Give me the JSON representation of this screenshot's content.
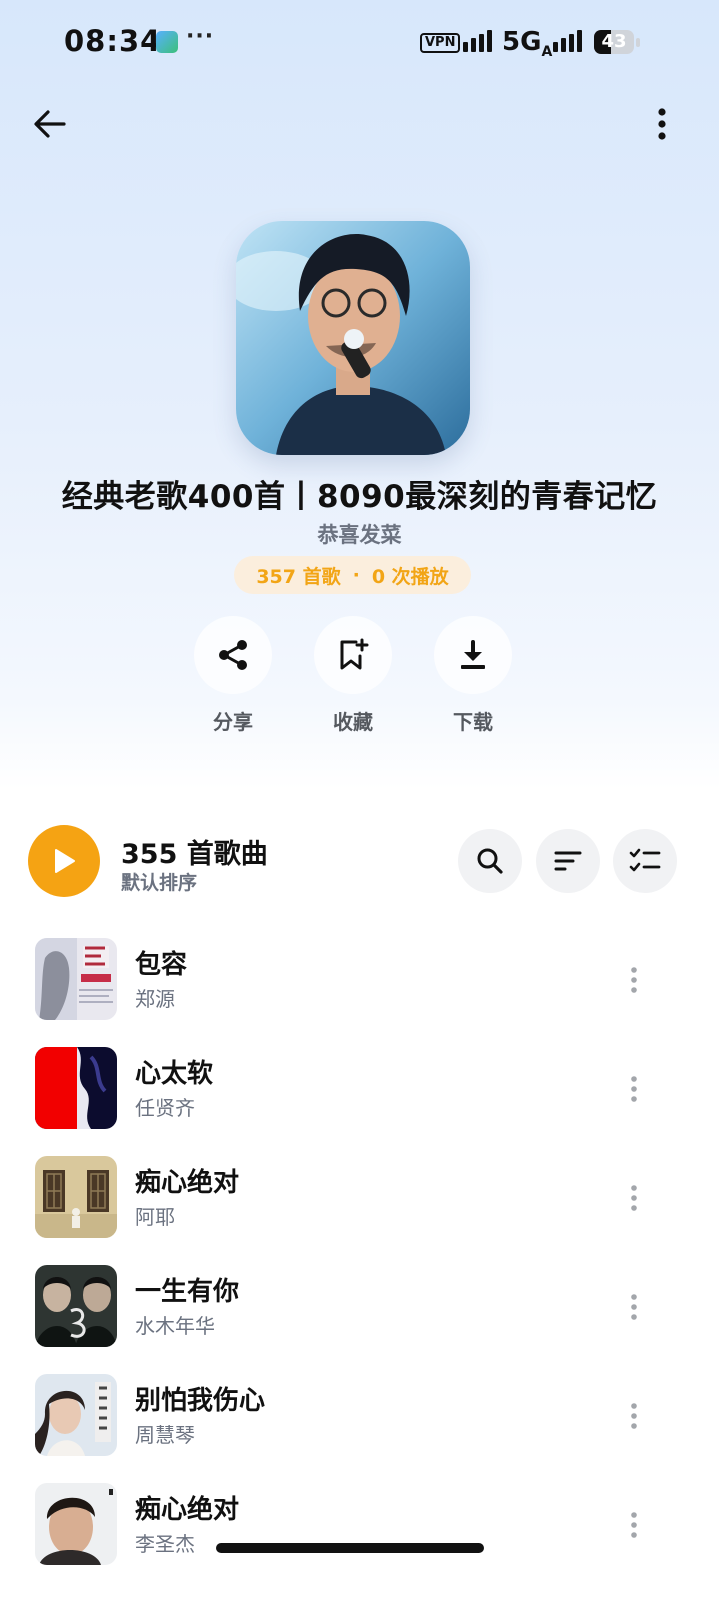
{
  "status_bar": {
    "time": "08:34",
    "dots": "···",
    "vpn": "VPN",
    "network": "5G",
    "network_sub": "A",
    "battery": "43",
    "battery_level": 0.43
  },
  "nav": {
    "back_icon": "arrow-left-icon",
    "more_icon": "more-vertical-icon"
  },
  "playlist": {
    "title": "经典老歌400首丨8090最深刻的青春记忆",
    "creator": "恭喜发菜",
    "song_count_label": "357 首歌",
    "separator": "·",
    "plays_label": "0 次播放"
  },
  "actions": [
    {
      "label": "分享",
      "icon": "share-icon"
    },
    {
      "label": "收藏",
      "icon": "bookmark-add-icon"
    },
    {
      "label": "下载",
      "icon": "download-icon"
    }
  ],
  "list_header": {
    "count_label": "355 首歌曲",
    "sort_label": "默认排序"
  },
  "songs": [
    {
      "title": "包容",
      "artist": "郑源"
    },
    {
      "title": "心太软",
      "artist": "任贤齐"
    },
    {
      "title": "痴心绝对",
      "artist": "阿耶"
    },
    {
      "title": "一生有你",
      "artist": "水木年华"
    },
    {
      "title": "别怕我伤心",
      "artist": "周慧琴"
    },
    {
      "title": "痴心绝对",
      "artist": "李圣杰"
    }
  ],
  "colors": {
    "accent": "#f5a313",
    "stats_text": "#f2a516",
    "stats_bg": "#fbeedd"
  }
}
